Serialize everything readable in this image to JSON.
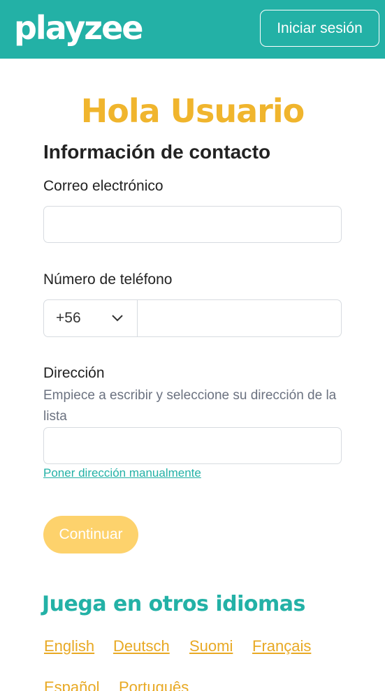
{
  "header": {
    "logo_text": "playzee",
    "login_label": "Iniciar sesión",
    "brand_color": "#23b1a6"
  },
  "main": {
    "greeting": "Hola Usuario",
    "section_title": "Información de contacto",
    "email": {
      "label": "Correo electrónico",
      "value": "",
      "placeholder": ""
    },
    "phone": {
      "label": "Número de teléfono",
      "country_code": "+56",
      "value": "",
      "placeholder": ""
    },
    "address": {
      "label": "Dirección",
      "helper": "Empiece a escribir y seleccione su dirección de la lista",
      "value": "",
      "placeholder": "",
      "manual_link": "Poner dirección manualmente"
    },
    "continue_label": "Continuar",
    "accent_color": "#f0b52d"
  },
  "languages": {
    "title": "Juega en otros idiomas",
    "items": [
      "English",
      "Deutsch",
      "Suomi",
      "Français",
      "Español",
      "Português"
    ]
  }
}
